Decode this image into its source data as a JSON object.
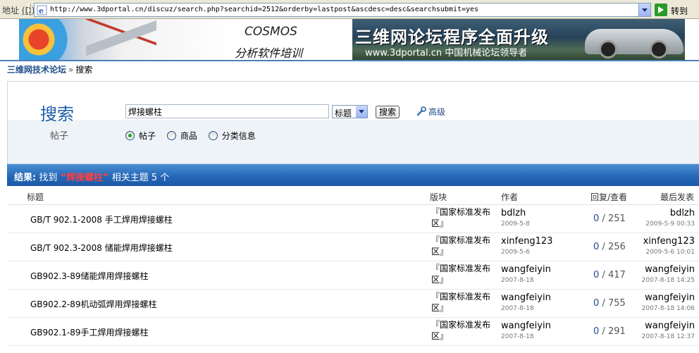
{
  "browser": {
    "address_label": "地址",
    "address_hotkey": "(D)",
    "url": "http://www.3dportal.cn/discuz/search.php?searchid=2512&orderby=lastpost&ascdesc=desc&searchsubmit=yes",
    "go_label": "转到"
  },
  "banner": {
    "left_title": "COSMOS",
    "left_subtitle": "分析软件培训",
    "right_title": "三维网论坛程序全面升级",
    "right_subtitle": "www.3dportal.cn 中国机械论坛领导者"
  },
  "breadcrumb": {
    "home": "三维网技术论坛",
    "separator": "»",
    "current": "搜索"
  },
  "search": {
    "heading": "搜索",
    "subheading": "帖子",
    "query": "焊接螺柱",
    "field_select": "标题",
    "submit_label": "搜索",
    "advanced_label": "高级",
    "scopes": [
      {
        "label": "帖子",
        "selected": true
      },
      {
        "label": "商品",
        "selected": false
      },
      {
        "label": "分类信息",
        "selected": false
      }
    ]
  },
  "results": {
    "prefix": "结果:",
    "found": "找到",
    "open_quote": "“",
    "keyword": "焊接螺柱",
    "close_quote": "”",
    "suffix": "相关主题",
    "count": "5 个",
    "columns": {
      "title": "标题",
      "forum": "版块",
      "author": "作者",
      "stats": "回复/查看",
      "last": "最后发表"
    },
    "rows": [
      {
        "title": "GB/T 902.1-2008 手工焊用焊接螺柱",
        "forum": "『国家标准发布区』",
        "author": "bdlzh",
        "date": "2009-5-8",
        "replies": "0",
        "views": "251",
        "last_by": "bdlzh",
        "last_date": "2009-5-9 00:33"
      },
      {
        "title": "GB/T 902.3-2008 储能焊用焊接螺柱",
        "forum": "『国家标准发布区』",
        "author": "xinfeng123",
        "date": "2009-5-6",
        "replies": "0",
        "views": "256",
        "last_by": "xinfeng123",
        "last_date": "2009-5-6 10:01"
      },
      {
        "title": "GB902.3-89储能焊用焊接螺柱",
        "forum": "『国家标准发布区』",
        "author": "wangfeiyin",
        "date": "2007-8-18",
        "replies": "0",
        "views": "417",
        "last_by": "wangfeiyin",
        "last_date": "2007-8-18 14:25"
      },
      {
        "title": "GB902.2-89机动弧焊用焊接螺柱",
        "forum": "『国家标准发布区』",
        "author": "wangfeiyin",
        "date": "2007-8-18",
        "replies": "0",
        "views": "755",
        "last_by": "wangfeiyin",
        "last_date": "2007-8-18 14:06"
      },
      {
        "title": "GB902.1-89手工焊用焊接螺柱",
        "forum": "『国家标准发布区』",
        "author": "wangfeiyin",
        "date": "2007-8-18",
        "replies": "0",
        "views": "291",
        "last_by": "wangfeiyin",
        "last_date": "2007-8-18 12:37"
      }
    ],
    "stats_separator": "/"
  },
  "colors": {
    "link": "#1e4d8a",
    "results_bar": "#2568b8",
    "keyword": "#ff4040"
  }
}
